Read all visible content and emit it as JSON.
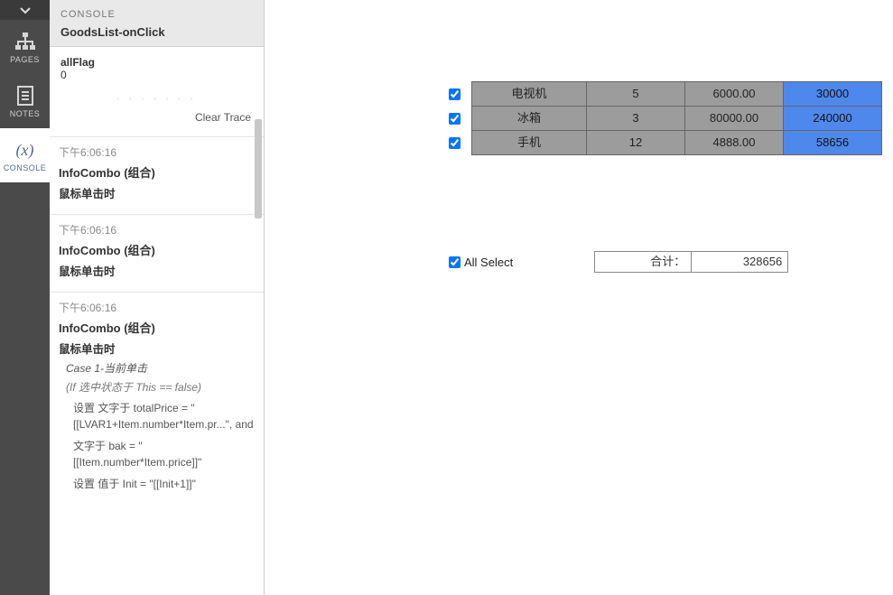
{
  "nav": {
    "pages": "PAGES",
    "notes": "NOTES",
    "console": "CONSOLE"
  },
  "consoleHeader": {
    "title": "CONSOLE",
    "subtitle": "GoodsList-onClick"
  },
  "vars": {
    "allFlag_name": "allFlag",
    "allFlag_val": "0"
  },
  "dots": ". . . . . . .",
  "clearTrace": "Clear Trace",
  "traces": {
    "t1_time": "下午6:06:16",
    "t1_src": "InfoCombo (组合)",
    "t1_evt": "鼠标单击时",
    "t2_time": "下午6:06:16",
    "t2_src": "InfoCombo (组合)",
    "t2_evt": "鼠标单击时",
    "t3_time": "下午6:06:16",
    "t3_src": "InfoCombo (组合)",
    "t3_evt": "鼠标单击时",
    "t3_case": "Case 1-当前单击",
    "t3_cond": "(If 选中状态于 This == false)",
    "t3_a1": "设置 文字于 totalPrice = \"[[LVAR1+Item.number*Item.pr...\", and",
    "t3_a2": "文字于 bak = \"[[Item.number*Item.price]]\"",
    "t3_a3": "设置 值于 Init = \"[[Init+1]]\""
  },
  "goods": {
    "r0": {
      "name": "电视机",
      "qty": "5",
      "price": "6000.00",
      "total": "30000"
    },
    "r1": {
      "name": "冰箱",
      "qty": "3",
      "price": "80000.00",
      "total": "240000"
    },
    "r2": {
      "name": "手机",
      "qty": "12",
      "price": "4888.00",
      "total": "58656"
    }
  },
  "footer": {
    "allSelect": "All Select",
    "sumLabel": "合计：",
    "sumVal": "328656"
  }
}
